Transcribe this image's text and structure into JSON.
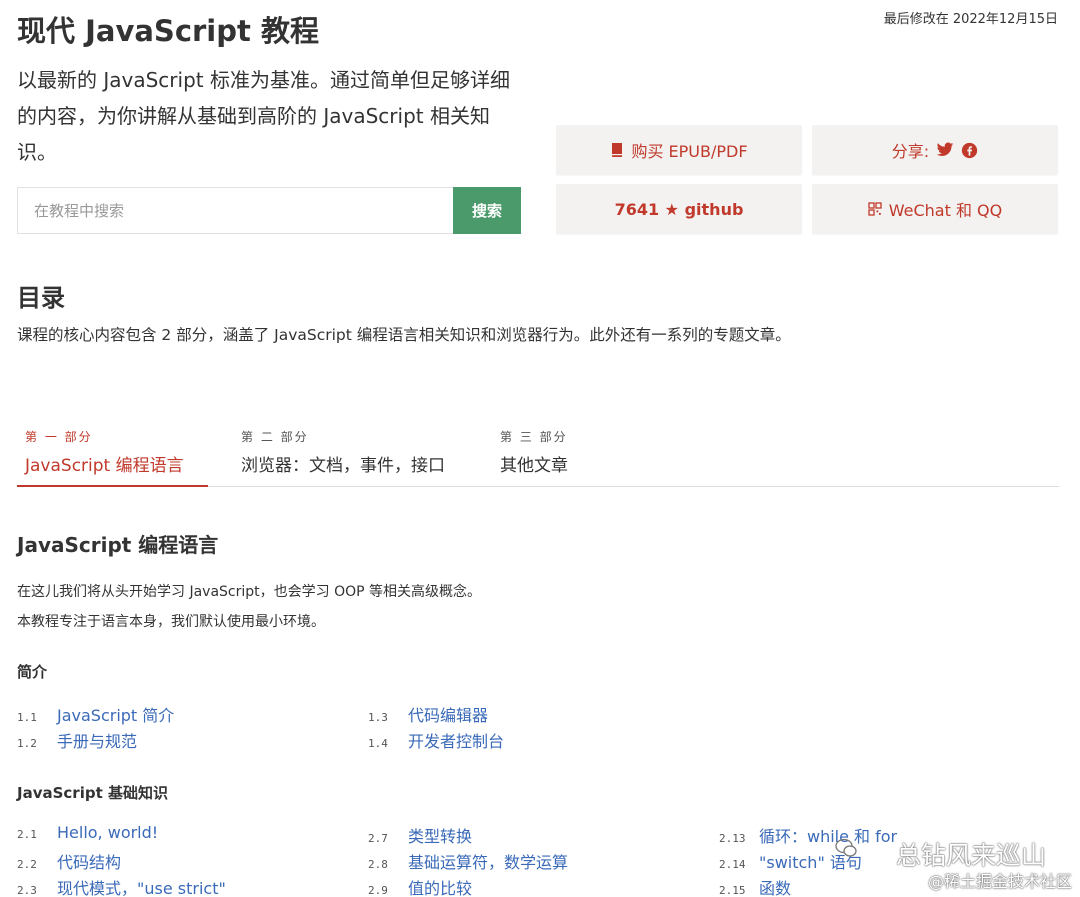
{
  "header": {
    "title": "现代 JavaScript 教程",
    "last_modified": "最后修改在 2022年12月15日",
    "lead": "以最新的 JavaScript 标准为基准。通过简单但足够详细的内容，为你讲解从基础到高阶的 JavaScript 相关知识。"
  },
  "search": {
    "placeholder": "在教程中搜索",
    "button_label": "搜索"
  },
  "actions": {
    "buy_label": "购买 EPUB/PDF",
    "share_label": "分享:",
    "github_label": "7641 ★ github",
    "wechat_label": "WeChat 和 QQ",
    "accent_color": "#c0392b"
  },
  "toc": {
    "heading": "目录",
    "description": "课程的核心内容包含 2 部分，涵盖了 JavaScript 编程语言相关知识和浏览器行为。此外还有一系列的专题文章。",
    "tabs": [
      {
        "kicker": "第 一 部分",
        "title": "JavaScript 编程语言",
        "active": true
      },
      {
        "kicker": "第 二 部分",
        "title": "浏览器：文档，事件，接口",
        "active": false
      },
      {
        "kicker": "第 三 部分",
        "title": "其他文章",
        "active": false
      }
    ]
  },
  "part": {
    "heading": "JavaScript 编程语言",
    "intro1": "在这儿我们将从头开始学习 JavaScript，也会学习 OOP 等相关高级概念。",
    "intro2": "本教程专注于语言本身，我们默认使用最小环境。"
  },
  "sections": [
    {
      "title": "简介",
      "lessons": [
        {
          "num": "1.1",
          "title": "JavaScript 简介"
        },
        {
          "num": "1.2",
          "title": "手册与规范"
        },
        {
          "num": "1.3",
          "title": "代码编辑器"
        },
        {
          "num": "1.4",
          "title": "开发者控制台"
        }
      ]
    },
    {
      "title": "JavaScript 基础知识",
      "lessons": [
        {
          "num": "2.1",
          "title": "Hello, world!"
        },
        {
          "num": "2.2",
          "title": "代码结构"
        },
        {
          "num": "2.3",
          "title": "现代模式，\"use strict\""
        },
        {
          "num": "2.7",
          "title": "类型转换"
        },
        {
          "num": "2.8",
          "title": "基础运算符，数学运算"
        },
        {
          "num": "2.9",
          "title": "值的比较"
        },
        {
          "num": "2.13",
          "title": "循环：while 和 for"
        },
        {
          "num": "2.14",
          "title": "\"switch\" 语句"
        },
        {
          "num": "2.15",
          "title": "函数"
        }
      ]
    }
  ],
  "watermark": {
    "line1": "总钻风来巡山",
    "line2": "@稀土掘金技术社区"
  }
}
